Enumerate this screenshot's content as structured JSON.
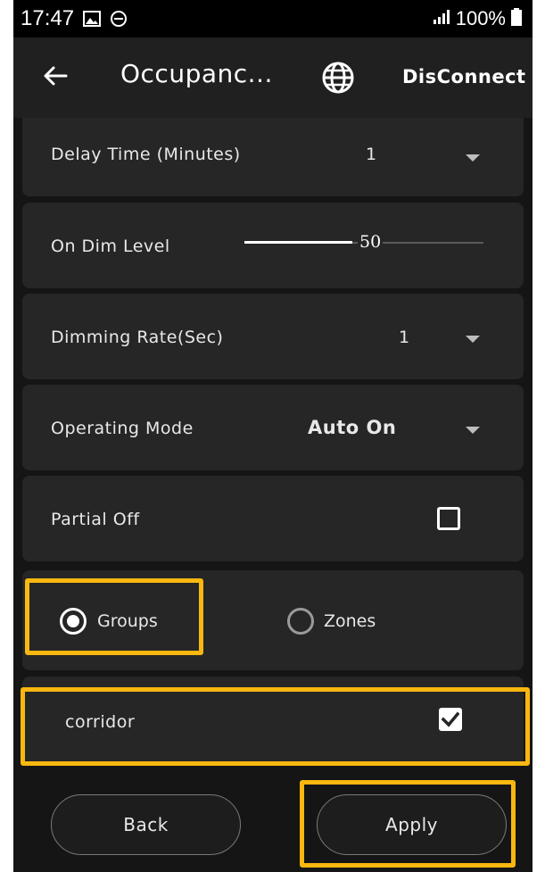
{
  "status_bar": {
    "time": "17:47",
    "battery": "100%"
  },
  "app_bar": {
    "title": "Occupanc...",
    "disconnect_label": "DisConnect"
  },
  "settings": {
    "delay_time": {
      "label": "Delay Time (Minutes)",
      "value": "1"
    },
    "on_dim_level": {
      "label": "On Dim Level",
      "value": "50",
      "fraction": 0.45
    },
    "dimming_rate": {
      "label": "Dimming Rate(Sec)",
      "value": "1"
    },
    "operating_mode": {
      "label": "Operating Mode",
      "value": "Auto On"
    },
    "partial_off": {
      "label": "Partial Off",
      "checked": false
    }
  },
  "selection": {
    "options": [
      {
        "label": "Groups",
        "selected": true
      },
      {
        "label": "Zones",
        "selected": false
      }
    ]
  },
  "group_list": [
    {
      "name": "corridor",
      "checked": true
    }
  ],
  "footer": {
    "back_label": "Back",
    "apply_label": "Apply"
  },
  "colors": {
    "highlight": "#f9b70f",
    "background": "#151515",
    "card": "#262626"
  },
  "icons": {
    "back": "arrow-left-icon",
    "globe": "globe-icon",
    "gallery": "image-icon",
    "dnd": "do-not-disturb-icon",
    "signal": "signal-icon",
    "battery": "battery-icon"
  }
}
